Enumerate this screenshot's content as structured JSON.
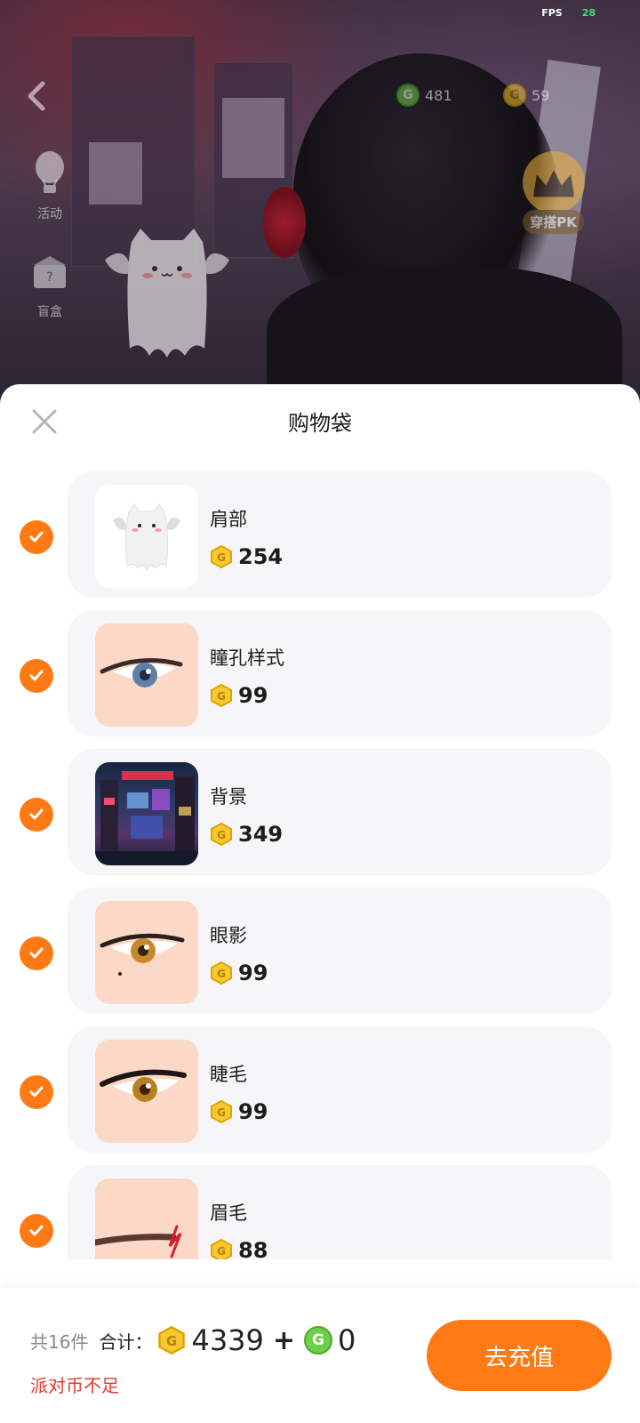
{
  "hud": {
    "fps_label": "FPS",
    "fps_value": "28",
    "green_currency": "481",
    "gold_currency": "59",
    "side_activity": "活动",
    "side_blindbox": "盲盒",
    "pk_label": "穿搭PK"
  },
  "sheet": {
    "title": "购物袋",
    "items": [
      {
        "name": "肩部",
        "price": "254",
        "thumb": "ghost"
      },
      {
        "name": "瞳孔样式",
        "price": "99",
        "thumb": "eye-blue"
      },
      {
        "name": "背景",
        "price": "349",
        "thumb": "city"
      },
      {
        "name": "眼影",
        "price": "99",
        "thumb": "eye-amber"
      },
      {
        "name": "睫毛",
        "price": "99",
        "thumb": "eye-lash"
      },
      {
        "name": "眉毛",
        "price": "88",
        "thumb": "brow"
      }
    ]
  },
  "footer": {
    "count": "共16件",
    "sum_label": "合计：",
    "gold_total": "4339",
    "plus": "+",
    "green_total": "0",
    "warning": "派对币不足",
    "recharge": "去充值"
  },
  "colors": {
    "accent": "#ff7a14",
    "warning": "#e8362e",
    "card_bg": "#f6f6f8"
  }
}
